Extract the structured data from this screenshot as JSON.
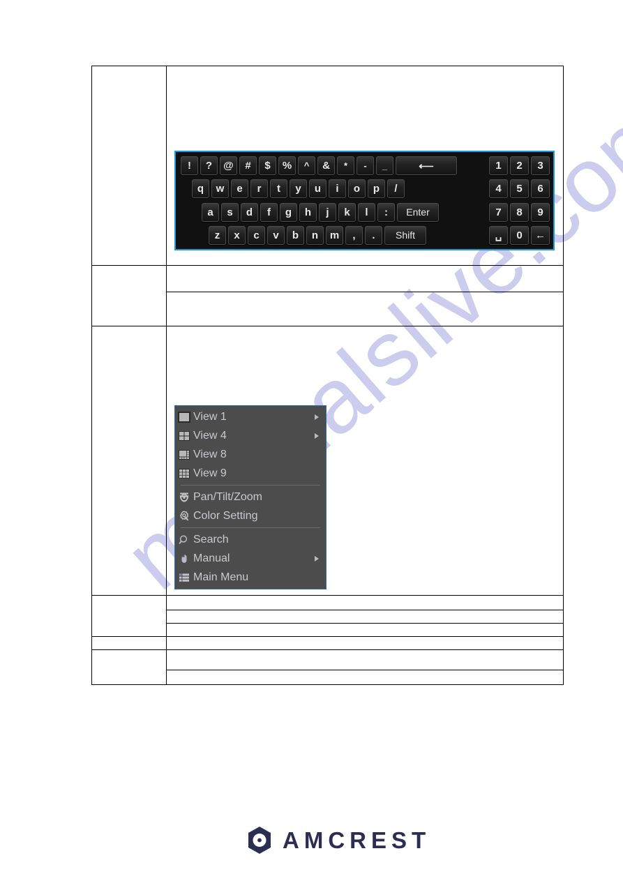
{
  "document": {
    "watermark_text": "manualslive.com",
    "watermark_color": "#b9bbe8"
  },
  "table": {
    "rows": [
      {
        "left": "",
        "right_cells": [
          ""
        ]
      },
      {
        "left": "",
        "right_cells": [
          "",
          ""
        ]
      },
      {
        "left": "",
        "right_cells": [
          ""
        ]
      },
      {
        "left": "",
        "right_cells": [
          "",
          "",
          ""
        ]
      },
      {
        "left": "",
        "right_cells": [
          ""
        ]
      },
      {
        "left": "",
        "right_cells": [
          "",
          ""
        ]
      }
    ]
  },
  "virtual_keyboard": {
    "border_color": "#1b9ad6",
    "background_color": "#111111",
    "rows": [
      {
        "keys": [
          "!",
          "?",
          "@",
          "#",
          "$",
          "%",
          "^",
          "&",
          "*",
          "-",
          "_"
        ],
        "backspace": "⟵"
      },
      {
        "keys": [
          "q",
          "w",
          "e",
          "r",
          "t",
          "y",
          "u",
          "i",
          "o",
          "p",
          "/"
        ]
      },
      {
        "keys": [
          "a",
          "s",
          "d",
          "f",
          "g",
          "h",
          "j",
          "k",
          "l",
          ":"
        ],
        "action": "Enter"
      },
      {
        "keys": [
          "z",
          "x",
          "c",
          "v",
          "b",
          "n",
          "m",
          ",",
          "."
        ],
        "action": "Shift"
      }
    ],
    "numpad": {
      "row1": [
        "1",
        "2",
        "3"
      ],
      "row2": [
        "4",
        "5",
        "6"
      ],
      "row3": [
        "7",
        "8",
        "9"
      ],
      "row4": [
        "␣",
        "0",
        "←"
      ]
    }
  },
  "context_menu": {
    "background_color": "#4c4c4c",
    "border_color": "#2b6ea8",
    "text_color": "#c9c9cf",
    "items": [
      {
        "label": "View 1",
        "icon": "view1-icon",
        "submenu": true
      },
      {
        "label": "View 4",
        "icon": "view4-icon",
        "submenu": true
      },
      {
        "label": "View 8",
        "icon": "view8-icon",
        "submenu": false
      },
      {
        "label": "View 9",
        "icon": "view9-icon",
        "submenu": false
      },
      {
        "label": "Pan/Tilt/Zoom",
        "icon": "dome-camera-icon",
        "submenu": false
      },
      {
        "label": "Color Setting",
        "icon": "color-setting-icon",
        "submenu": false
      },
      {
        "label": "Search",
        "icon": "magnifier-icon",
        "submenu": false
      },
      {
        "label": "Manual",
        "icon": "mouse-icon",
        "submenu": true
      },
      {
        "label": "Main Menu",
        "icon": "list-icon",
        "submenu": false
      }
    ]
  },
  "footer": {
    "brand": "AMCREST",
    "brand_color": "#2b2d52",
    "logo_icon": "amcrest-hexagon-logo"
  }
}
